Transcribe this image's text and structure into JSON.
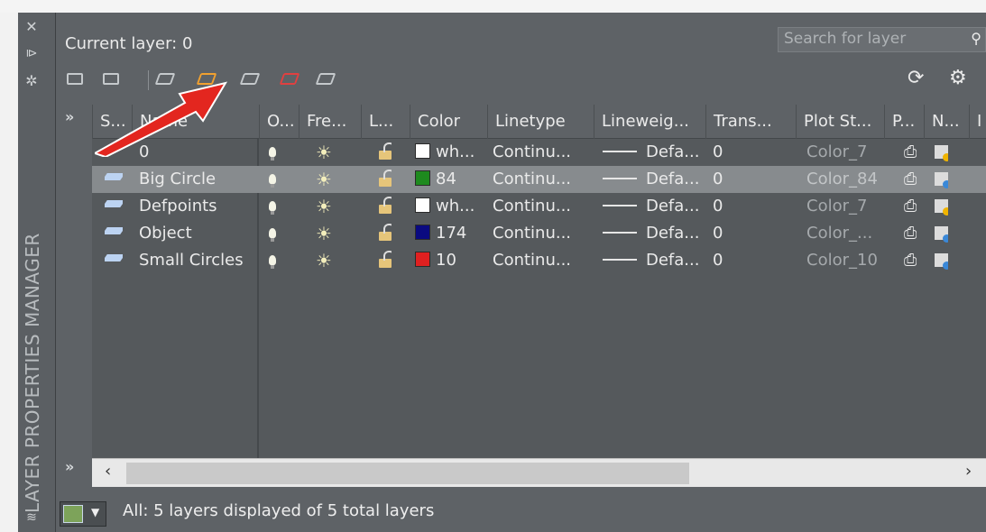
{
  "panel": {
    "title_vertical": "LAYER PROPERTIES MANAGER",
    "current_layer_label": "Current layer: 0",
    "search_placeholder": "Search for layer",
    "status_text": "All: 5 layers displayed of 5 total layers"
  },
  "columns": [
    "S...",
    "Name",
    "O...",
    "Fre...",
    "L...",
    "Color",
    "Linetype",
    "Lineweig...",
    "Trans...",
    "Plot St...",
    "P...",
    "N...",
    "I"
  ],
  "rows": [
    {
      "status": "current-check",
      "name": "0",
      "color_name": "wh...",
      "color_hex": "#ffffff",
      "linetype": "Continu...",
      "lineweight": "Defa...",
      "transparency": "0",
      "plot_style": "Color_7",
      "new_vp_dot": "#f0b400",
      "selected": false
    },
    {
      "status": "layer",
      "name": "Big Circle",
      "color_name": "84",
      "color_hex": "#1e8a1e",
      "linetype": "Continu...",
      "lineweight": "Defa...",
      "transparency": "0",
      "plot_style": "Color_84",
      "new_vp_dot": "#3a88d8",
      "selected": true
    },
    {
      "status": "layer",
      "name": "Defpoints",
      "color_name": "wh...",
      "color_hex": "#ffffff",
      "linetype": "Continu...",
      "lineweight": "Defa...",
      "transparency": "0",
      "plot_style": "Color_7",
      "new_vp_dot": "#f0b400",
      "selected": false
    },
    {
      "status": "layer",
      "name": "Object",
      "color_name": "174",
      "color_hex": "#0a0a80",
      "linetype": "Continu...",
      "lineweight": "Defa...",
      "transparency": "0",
      "plot_style": "Color_...",
      "new_vp_dot": "#3a88d8",
      "selected": false
    },
    {
      "status": "layer",
      "name": "Small Circles",
      "color_name": "10",
      "color_hex": "#e02020",
      "linetype": "Continu...",
      "lineweight": "Defa...",
      "transparency": "0",
      "plot_style": "Color_10",
      "new_vp_dot": "#3a88d8",
      "selected": false
    }
  ],
  "icons": {
    "close": "close-icon",
    "autohide": "autohide-icon",
    "properties": "properties-icon",
    "refresh": "refresh-icon",
    "settings": "gear-icon"
  },
  "annotation": {
    "arrow_color": "#e3261f"
  }
}
